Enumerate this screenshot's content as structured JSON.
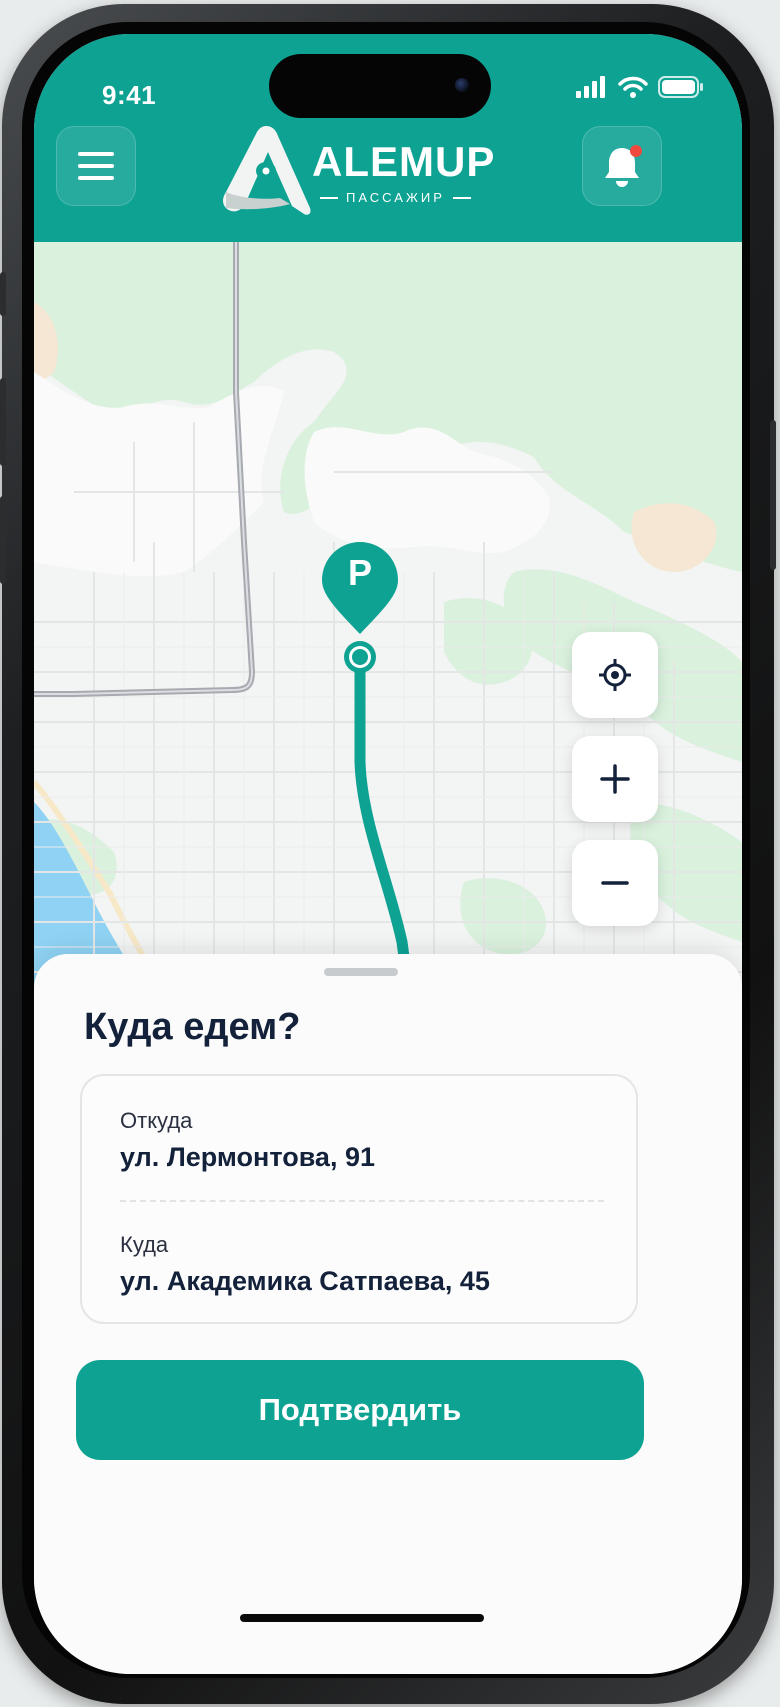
{
  "status_bar": {
    "time": "9:41"
  },
  "brand": {
    "name": "ALEMUP",
    "subtitle": "ПАССАЖИР"
  },
  "map": {
    "marker_label": "P"
  },
  "sheet": {
    "title": "Куда едем?",
    "from_label": "Откуда",
    "from_value": "ул. Лермонтова, 91",
    "to_label": "Куда",
    "to_value": "ул. Академика Сатпаева, 45",
    "confirm_label": "Подтвердить"
  },
  "colors": {
    "accent": "#0ea293",
    "map_park": "#d9f1dd",
    "map_water": "#8fd2f3",
    "notification_dot": "#f04a3f"
  },
  "icons": {
    "menu": "menu-icon",
    "notifications": "bell-icon",
    "locate": "crosshair-icon",
    "zoom_in": "plus-icon",
    "zoom_out": "minus-icon"
  }
}
